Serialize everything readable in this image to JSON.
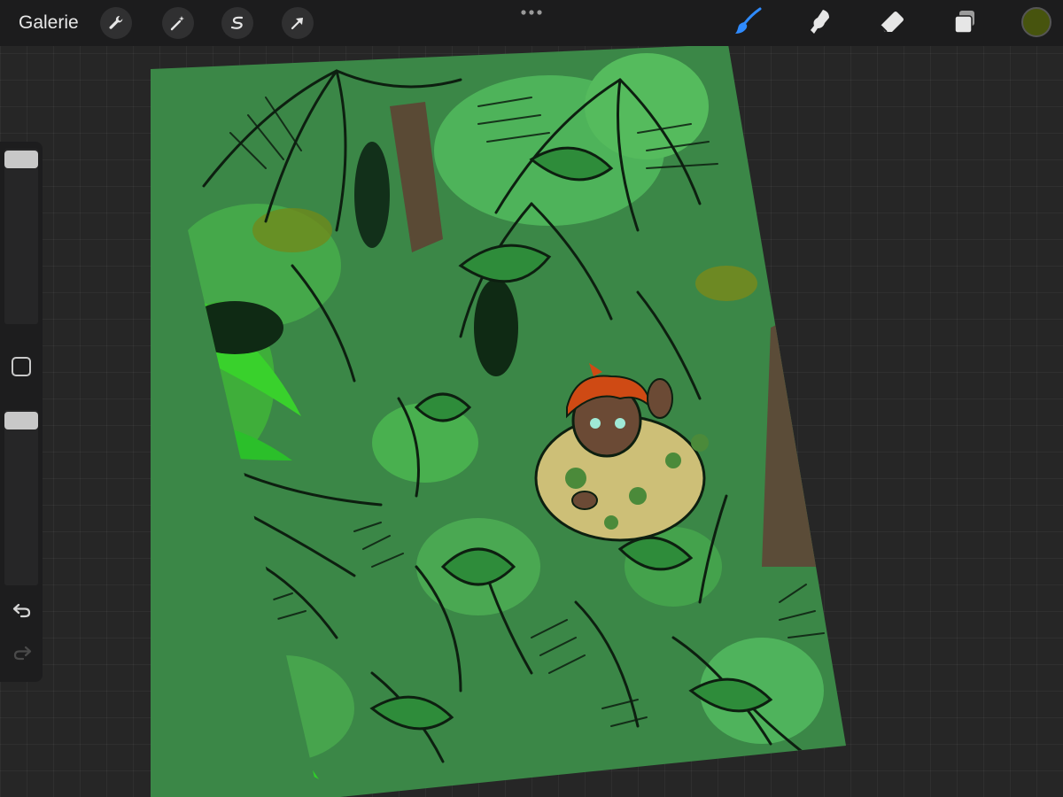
{
  "topbar": {
    "gallery_label": "Galerie",
    "tools": [
      {
        "icon": "wrench-icon",
        "name": "actions"
      },
      {
        "icon": "magic-wand-icon",
        "name": "adjustments"
      },
      {
        "icon": "selection-icon",
        "name": "selection"
      },
      {
        "icon": "arrow-cursor-icon",
        "name": "transform"
      }
    ],
    "more_icon": "more-dots-icon",
    "right_tools": [
      {
        "icon": "brush-icon",
        "name": "paint",
        "active": true
      },
      {
        "icon": "smudge-icon",
        "name": "smudge",
        "active": false
      },
      {
        "icon": "eraser-icon",
        "name": "eraser",
        "active": false
      },
      {
        "icon": "layers-icon",
        "name": "layers",
        "active": false
      }
    ],
    "current_color": "#47540e"
  },
  "sidebar": {
    "brush_size_level": 0.0,
    "opacity_level": 0.0,
    "modify_icon": "square-icon",
    "undo_icon": "undo-icon",
    "redo_icon": "redo-icon"
  },
  "colors": {
    "accent": "#2f8bff",
    "canvas_base": "#3d8a4a",
    "ui_dark": "#1c1c1d",
    "hair": "#cf4a14",
    "sweater": "#cdbf77"
  }
}
